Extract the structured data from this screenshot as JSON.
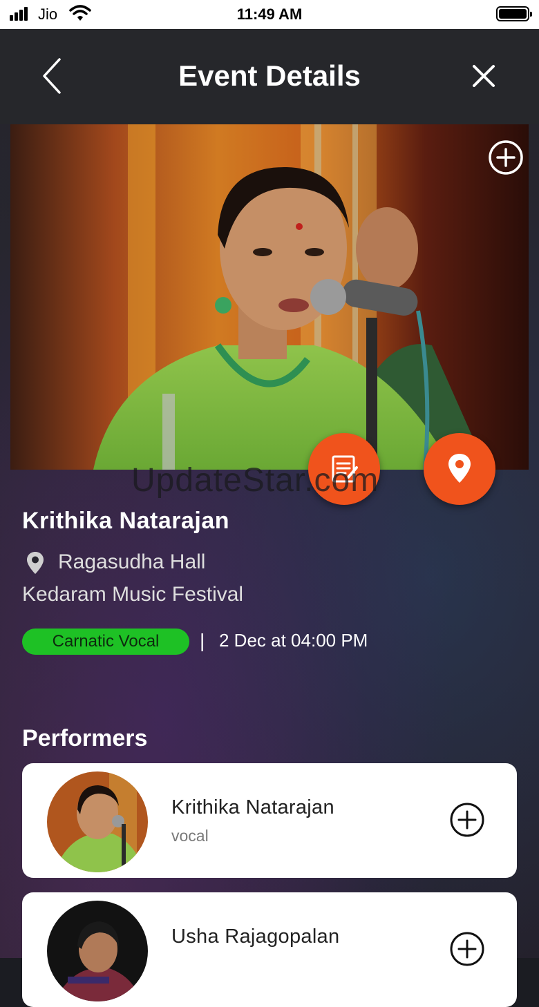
{
  "status_bar": {
    "carrier": "Jio",
    "time": "11:49 AM"
  },
  "header": {
    "title": "Event Details",
    "back_icon": "chevron-left-icon",
    "close_icon": "close-icon"
  },
  "watermark": "UpdateStar.com",
  "event": {
    "performer": "Krithika Natarajan",
    "venue": "Ragasudha Hall",
    "festival": "Kedaram Music Festival",
    "genre": "Carnatic Vocal",
    "separator": "|",
    "datetime": "2 Dec at 04:00 PM"
  },
  "actions": {
    "add_icon": "plus-circle-icon",
    "notes_icon": "notepad-icon",
    "location_icon": "map-pin-icon"
  },
  "colors": {
    "accent": "#f0531c",
    "tag": "#1ec125",
    "header_bg": "#26272b"
  },
  "performers": {
    "heading": "Performers",
    "items": [
      {
        "name": "Krithika Natarajan",
        "role": "vocal"
      },
      {
        "name": "Usha Rajagopalan",
        "role": ""
      }
    ]
  }
}
